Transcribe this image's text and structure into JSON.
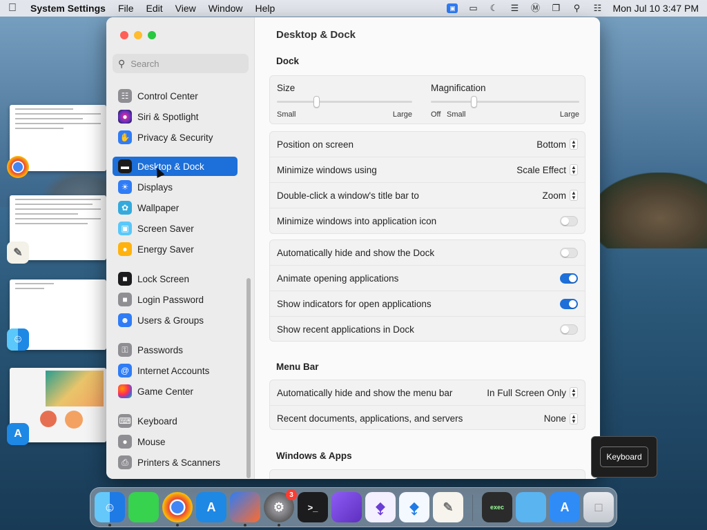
{
  "menubar": {
    "app_name": "System Settings",
    "menus": [
      "File",
      "Edit",
      "View",
      "Window",
      "Help"
    ],
    "clock": "Mon Jul 10  3:47 PM"
  },
  "sidebar": {
    "search_placeholder": "Search",
    "items": [
      {
        "label": "Control Center",
        "color": "#8e8e93"
      },
      {
        "label": "Siri & Spotlight",
        "color": "#5e2fbf"
      },
      {
        "label": "Privacy & Security",
        "color": "#2f7cf6"
      },
      {
        "label": "Desktop & Dock",
        "color": "#1b1b1b"
      },
      {
        "label": "Displays",
        "color": "#2f7cf6"
      },
      {
        "label": "Wallpaper",
        "color": "#34aadc"
      },
      {
        "label": "Screen Saver",
        "color": "#5ac8fa"
      },
      {
        "label": "Energy Saver",
        "color": "#ffb20f"
      },
      {
        "label": "Lock Screen",
        "color": "#1c1c1e"
      },
      {
        "label": "Login Password",
        "color": "#8e8e93"
      },
      {
        "label": "Users & Groups",
        "color": "#2f7cf6"
      },
      {
        "label": "Passwords",
        "color": "#8e8e93"
      },
      {
        "label": "Internet Accounts",
        "color": "#2f7cf6"
      },
      {
        "label": "Game Center",
        "color": "#ff2d55"
      },
      {
        "label": "Keyboard",
        "color": "#8e8e93"
      },
      {
        "label": "Mouse",
        "color": "#8e8e93"
      },
      {
        "label": "Printers & Scanners",
        "color": "#8e8e93"
      }
    ]
  },
  "main": {
    "title": "Desktop & Dock",
    "dock_section": "Dock",
    "size_label": "Size",
    "size_small": "Small",
    "size_large": "Large",
    "magnification_label": "Magnification",
    "mag_off": "Off",
    "mag_small": "Small",
    "mag_large": "Large",
    "size_value": 0.29,
    "magnification_value": 0.29,
    "rows_a": [
      {
        "label": "Position on screen",
        "value": "Bottom"
      },
      {
        "label": "Minimize windows using",
        "value": "Scale Effect"
      },
      {
        "label": "Double-click a window's title bar to",
        "value": "Zoom"
      },
      {
        "label": "Minimize windows into application icon",
        "toggle": false
      }
    ],
    "rows_b": [
      {
        "label": "Automatically hide and show the Dock",
        "toggle": false
      },
      {
        "label": "Animate opening applications",
        "toggle": true
      },
      {
        "label": "Show indicators for open applications",
        "toggle": true
      },
      {
        "label": "Show recent applications in Dock",
        "toggle": false
      }
    ],
    "menu_bar_section": "Menu Bar",
    "rows_c": [
      {
        "label": "Automatically hide and show the menu bar",
        "value": "In Full Screen Only"
      },
      {
        "label": "Recent documents, applications, and servers",
        "value": "None"
      }
    ],
    "windows_section": "Windows & Apps"
  },
  "tooltip": {
    "label": "Keyboard"
  },
  "dock": {
    "apps": [
      "Finder",
      "Notes",
      "Chrome",
      "App Store",
      "Workbench",
      "System Settings",
      "Terminal",
      "Apps",
      "Visual Studio",
      "VS Code",
      "TextEdit",
      "Exec",
      "Folder",
      "Xcode",
      "Trash"
    ],
    "settings_badge": "3"
  }
}
